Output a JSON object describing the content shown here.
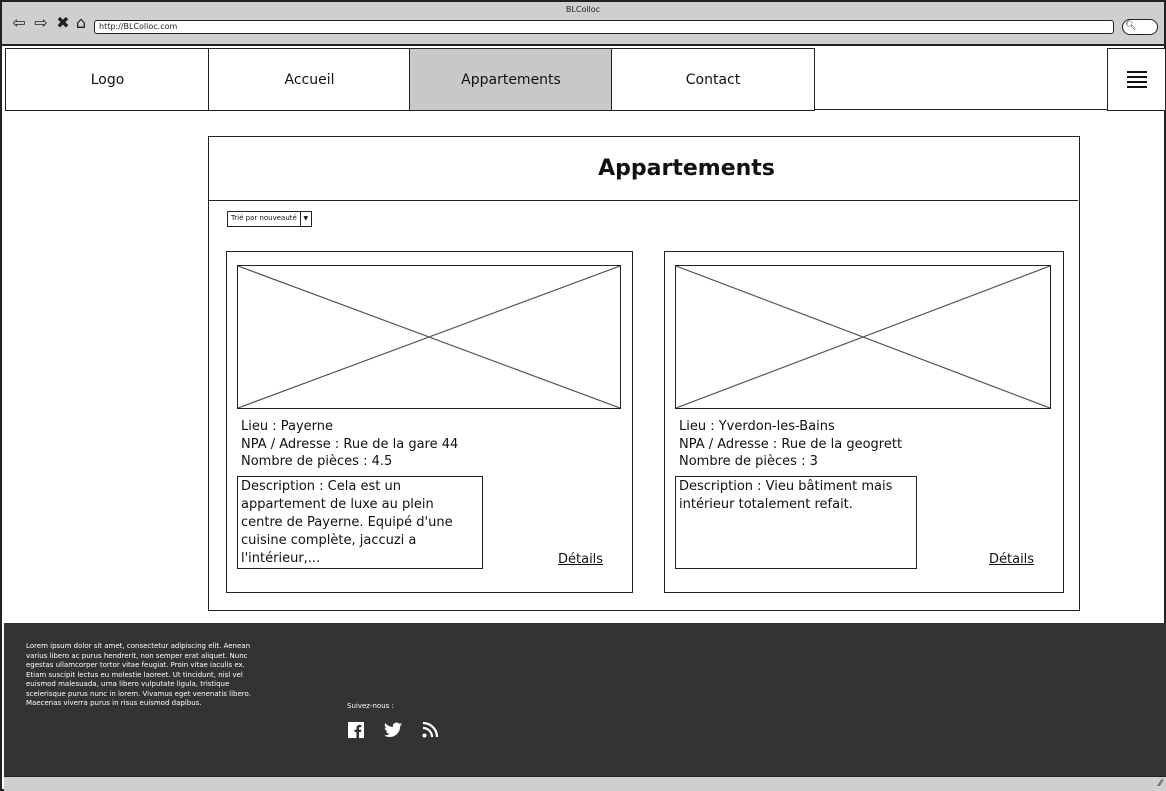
{
  "window": {
    "title": "BLColloc",
    "url": "http://BLColloc.com"
  },
  "nav": {
    "items": [
      {
        "label": "Logo"
      },
      {
        "label": "Accueil"
      },
      {
        "label": "Appartements"
      },
      {
        "label": "Contact"
      }
    ],
    "active": "Appartements"
  },
  "page": {
    "title": "Appartements",
    "sort_label": "Trié par nouveauté"
  },
  "listings": [
    {
      "lieu": "Lieu : Payerne",
      "adresse": "NPA / Adresse : Rue de la gare 44",
      "pieces": "Nombre de pièces : 4.5",
      "description": "Description : Cela est un appartement de luxe au plein centre de Payerne. Equipé d'une cuisine complète, jaccuzi a l'intérieur,...",
      "details": "Détails"
    },
    {
      "lieu": "Lieu : Yverdon-les-Bains",
      "adresse": "NPA / Adresse : Rue de la geogrett",
      "pieces": "Nombre de pièces : 3",
      "description": "Description : Vieu bâtiment mais intérieur totalement refait.",
      "details": "Détails"
    }
  ],
  "footer": {
    "text": "Lorem ipsum dolor sit amet, consectetur adipiscing elit. Aenean varius libero ac purus hendrerit, non semper erat aliquet. Nunc egestas ullamcorper tortor vitae feugiat. Proin vitae iaculis ex. Etiam suscipit lectus eu molestie laoreet. Ut tincidunt, nisl vel euismod malesuada, urna libero vulputate ligula, tristique scelerisque purus nunc in lorem. Vivamus eget venenatis libero. Maecenas viverra purus in risus euismod dapibus.",
    "follow_label": "Suivez-nous :",
    "social_icons": [
      "facebook-icon",
      "twitter-icon",
      "rss-icon"
    ]
  },
  "colors": {
    "active_tab": "#c8c8c8",
    "footer_bg": "#333333",
    "chrome": "#cfcfcf"
  }
}
